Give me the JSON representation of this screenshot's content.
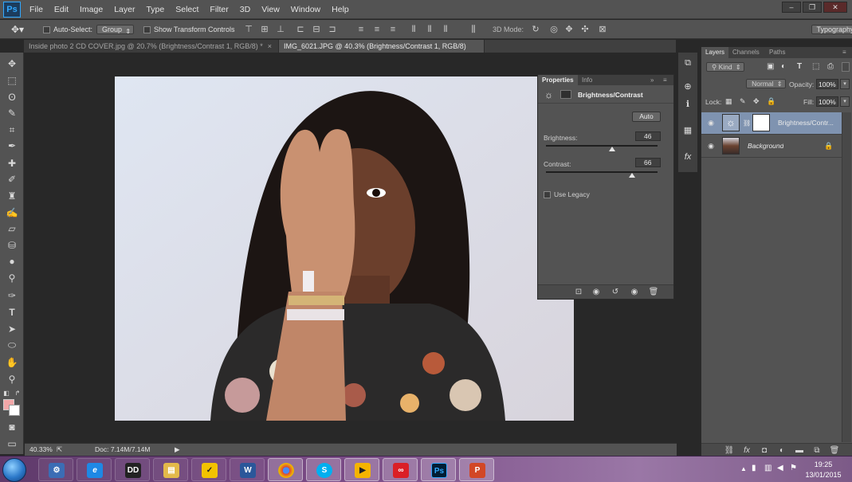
{
  "app": {
    "logo": "Ps"
  },
  "menu": [
    "File",
    "Edit",
    "Image",
    "Layer",
    "Type",
    "Select",
    "Filter",
    "3D",
    "View",
    "Window",
    "Help"
  ],
  "window_controls": [
    "–",
    "❐",
    "✕"
  ],
  "options": {
    "auto_select_label": "Auto-Select:",
    "auto_select_value": "Group",
    "show_transform_label": "Show Transform Controls",
    "mode_3d_label": "3D Mode:",
    "workspace": "Typography"
  },
  "tabs": [
    {
      "title": "Inside photo 2 CD COVER.jpg @ 20.7% (Brightness/Contrast 1, RGB/8) *",
      "close": "×"
    },
    {
      "title": "IMG_6021.JPG @ 40.3% (Brightness/Contrast 1, RGB/8) *",
      "close": "×"
    }
  ],
  "status": {
    "zoom": "40.33%",
    "doc": "Doc: 7.14M/7.14M"
  },
  "properties": {
    "tab_properties": "Properties",
    "tab_info": "Info",
    "adjustment_title": "Brightness/Contrast",
    "auto_label": "Auto",
    "brightness_label": "Brightness:",
    "brightness_value": "46",
    "brightness_level": 0.59,
    "contrast_label": "Contrast:",
    "contrast_value": "66",
    "contrast_level": 0.77,
    "legacy_label": "Use Legacy"
  },
  "layers": {
    "tab_layers": "Layers",
    "tab_channels": "Channels",
    "tab_paths": "Paths",
    "filter_kind": "Kind",
    "blend_mode": "Normal",
    "opacity_label": "Opacity:",
    "opacity_value": "100%",
    "lock_label": "Lock:",
    "fill_label": "Fill:",
    "fill_value": "100%",
    "items": [
      {
        "name": "Brightness/Contr..."
      },
      {
        "name": "Background"
      }
    ]
  },
  "taskbar": {
    "time": "19:25",
    "date": "13/01/2015"
  }
}
